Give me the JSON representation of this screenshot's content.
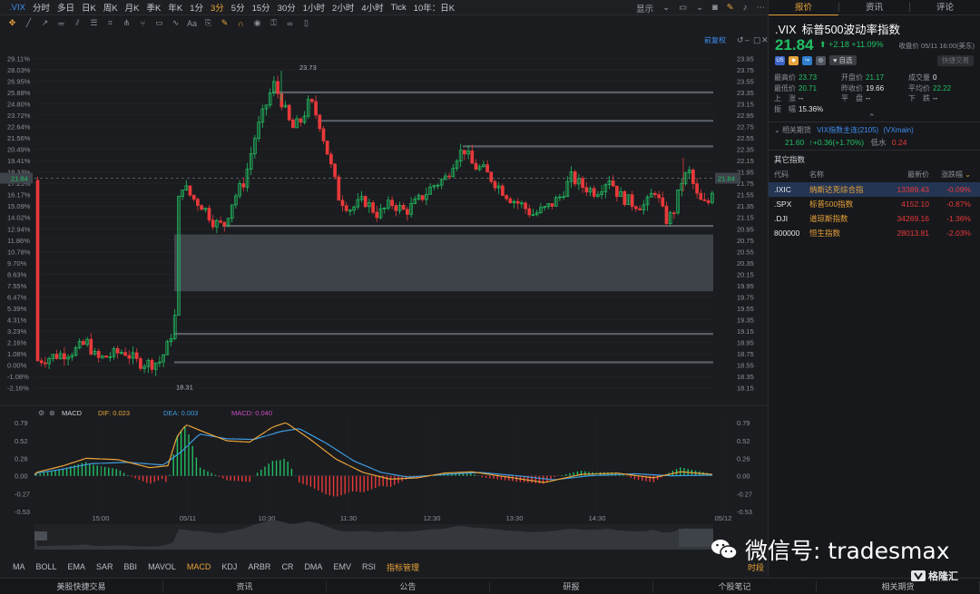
{
  "toolbar": {
    "symbol": ".VIX",
    "periods": [
      "分时",
      "多日",
      "日K",
      "周K",
      "月K",
      "季K",
      "年K",
      "1分",
      "3分",
      "5分",
      "15分",
      "30分",
      "1小时",
      "2小时",
      "4小时",
      "Tick",
      "10年：日K"
    ],
    "active_period": "3分",
    "display_label": "显示",
    "adjust_label": "前复权"
  },
  "right_tabs": [
    "报价",
    "资讯",
    "评论"
  ],
  "quote": {
    "symbol": ".VIX",
    "name": "标普500波动率指数",
    "price": "21.84",
    "change": "+2.18",
    "change_pct": "+11.09%",
    "close_info": "收盘价 05/11 16:00(美东)",
    "watch_label": "自选",
    "trade_label": "快捷交易",
    "stats": [
      [
        {
          "l": "最高价",
          "v": "23.73",
          "c": "g"
        },
        {
          "l": "开盘价",
          "v": "21.17",
          "c": "g"
        },
        {
          "l": "成交量",
          "v": "0",
          "c": "w"
        }
      ],
      [
        {
          "l": "最低价",
          "v": "20.71",
          "c": "g"
        },
        {
          "l": "昨收价",
          "v": "19.66",
          "c": "w"
        },
        {
          "l": "平均价",
          "v": "22.22",
          "c": "g"
        }
      ],
      [
        {
          "l": "上　涨",
          "v": "--",
          "c": "w"
        },
        {
          "l": "平　盘",
          "v": "--",
          "c": "w"
        },
        {
          "l": "下　跌",
          "v": "--",
          "c": "w"
        }
      ],
      [
        {
          "l": "振　幅",
          "v": "15.36%",
          "c": "w"
        }
      ]
    ],
    "related_label": "相关期货",
    "related_name": "VIX指数主连(2105)",
    "related_code": "(VXmain)",
    "related_price": "21.60",
    "related_change": "+0.36(+1.70%)",
    "related_water_label": "低水",
    "related_water": "0.24"
  },
  "other_indices": {
    "title": "其它指数",
    "headers": [
      "代码",
      "名称",
      "最新价",
      "涨跌幅"
    ],
    "rows": [
      {
        "code": ".IXIC",
        "name": "纳斯达克综合指",
        "price": "13389.43",
        "pct": "-0.09%"
      },
      {
        "code": ".SPX",
        "name": "标普500指数",
        "price": "4152.10",
        "pct": "-0.87%"
      },
      {
        "code": ".DJI",
        "name": "道琼斯指数",
        "price": "34269.16",
        "pct": "-1.36%"
      },
      {
        "code": "800000",
        "name": "恒生指数",
        "price": "28013.81",
        "pct": "-2.03%"
      }
    ]
  },
  "chart_data": {
    "type": "candlestick",
    "price_axis_right": [
      "23.95",
      "23.75",
      "23.55",
      "23.35",
      "23.15",
      "22.95",
      "22.75",
      "22.55",
      "22.35",
      "22.15",
      "21.95",
      "21.75",
      "21.55",
      "21.35",
      "21.15",
      "20.95",
      "20.75",
      "20.55",
      "20.35",
      "20.15",
      "19.95",
      "19.75",
      "19.55",
      "19.35",
      "19.15",
      "18.95",
      "18.75",
      "18.55",
      "18.35",
      "18.15"
    ],
    "pct_axis_left": [
      "29.11%",
      "28.03%",
      "26.95%",
      "25.88%",
      "24.80%",
      "23.72%",
      "22.64%",
      "21.56%",
      "20.49%",
      "19.41%",
      "18.33%",
      "17.25%",
      "16.17%",
      "15.09%",
      "14.02%",
      "12.94%",
      "11.86%",
      "10.78%",
      "9.70%",
      "8.63%",
      "7.55%",
      "6.47%",
      "5.39%",
      "4.31%",
      "3.23%",
      "2.16%",
      "1.08%",
      "0.00%",
      "-1.08%",
      "-2.16%"
    ],
    "current_price": "21.84",
    "high_label": "23.73",
    "low_label": "18.31",
    "price_range": [
      18.05,
      24.05
    ],
    "support_lines": [
      23.35,
      22.85,
      22.4,
      21.0,
      19.1,
      18.6
    ],
    "gap_zone": [
      19.85,
      20.85
    ],
    "time_labels": [
      "15:00",
      "05/11",
      "10:30",
      "11:30",
      "12:30",
      "13:30",
      "14:30",
      "05/12"
    ],
    "macd": {
      "label": "MACD",
      "dif_label": "DIF: 0.023",
      "dea_label": "DEA: 0.003",
      "macd_label": "MACD: 0.040",
      "axis": [
        "0.79",
        "0.52",
        "0.26",
        "0.00",
        "-0.27",
        "-0.53"
      ],
      "colors": {
        "dif": "#e8a33a",
        "dea": "#3d9be0",
        "macd": "#c84ec4"
      }
    }
  },
  "indicators": [
    "MA",
    "BOLL",
    "EMA",
    "SAR",
    "BBI",
    "MAVOL",
    "MACD",
    "KDJ",
    "ARBR",
    "CR",
    "DMA",
    "EMV",
    "RSI",
    "指标管理"
  ],
  "active_indicator": "MACD",
  "indicator_right": "时段",
  "bottom_bar": [
    "美股快捷交易",
    "资讯",
    "公告",
    "研报",
    "个股笔记",
    "相关期货"
  ],
  "watermark": "微信号: tradesmax",
  "brand": "格隆汇"
}
